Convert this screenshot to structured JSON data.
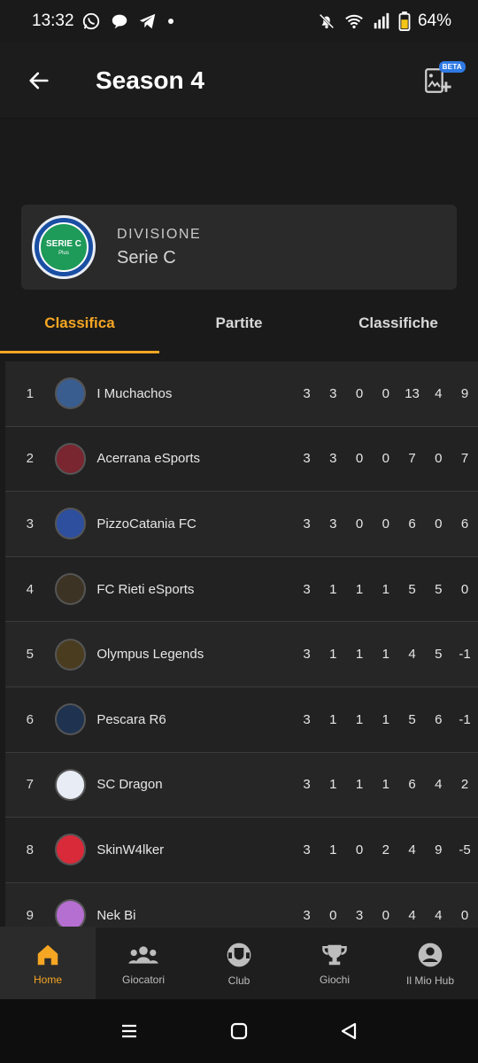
{
  "status_bar": {
    "time": "13:32",
    "battery": "64%"
  },
  "header": {
    "title": "Season 4",
    "beta_badge": "BETA"
  },
  "division": {
    "label": "DIVISIONE",
    "name": "Serie C",
    "logo_text": "SERIE C",
    "logo_sub": "Plus"
  },
  "tabs": [
    {
      "label": "Classifica",
      "active": true
    },
    {
      "label": "Partite",
      "active": false
    },
    {
      "label": "Classifiche",
      "active": false
    }
  ],
  "standings": [
    {
      "pos": "1",
      "team": "I Muchachos",
      "stats": [
        "3",
        "3",
        "0",
        "0",
        "13",
        "4",
        "9"
      ],
      "crest_color": "#3a5d8f"
    },
    {
      "pos": "2",
      "team": "Acerrana eSports",
      "stats": [
        "3",
        "3",
        "0",
        "0",
        "7",
        "0",
        "7"
      ],
      "crest_color": "#7a2630"
    },
    {
      "pos": "3",
      "team": "PizzoCatania FC",
      "stats": [
        "3",
        "3",
        "0",
        "0",
        "6",
        "0",
        "6"
      ],
      "crest_color": "#2e4f9e"
    },
    {
      "pos": "4",
      "team": "FC Rieti eSports",
      "stats": [
        "3",
        "1",
        "1",
        "1",
        "5",
        "5",
        "0"
      ],
      "crest_color": "#3d3324"
    },
    {
      "pos": "5",
      "team": "Olympus Legends",
      "stats": [
        "3",
        "1",
        "1",
        "1",
        "4",
        "5",
        "-1"
      ],
      "crest_color": "#4a3c1e"
    },
    {
      "pos": "6",
      "team": "Pescara R6",
      "stats": [
        "3",
        "1",
        "1",
        "1",
        "5",
        "6",
        "-1"
      ],
      "crest_color": "#1f3350"
    },
    {
      "pos": "7",
      "team": "SC Dragon",
      "stats": [
        "3",
        "1",
        "1",
        "1",
        "6",
        "4",
        "2"
      ],
      "crest_color": "#e8ecf4"
    },
    {
      "pos": "8",
      "team": "SkinW4lker",
      "stats": [
        "3",
        "1",
        "0",
        "2",
        "4",
        "9",
        "-5"
      ],
      "crest_color": "#d92a3a"
    },
    {
      "pos": "9",
      "team": "Nek Bi",
      "stats": [
        "3",
        "0",
        "3",
        "0",
        "4",
        "4",
        "0"
      ],
      "crest_color": "#b46fd1"
    }
  ],
  "bottom_nav": [
    {
      "label": "Home",
      "icon": "home-icon",
      "active": true
    },
    {
      "label": "Giocatori",
      "icon": "players-icon",
      "active": false
    },
    {
      "label": "Club",
      "icon": "club-icon",
      "active": false
    },
    {
      "label": "Giochi",
      "icon": "trophy-icon",
      "active": false
    },
    {
      "label": "Il Mio Hub",
      "icon": "account-icon",
      "active": false
    }
  ],
  "colors": {
    "accent": "#f5a623",
    "background": "#1a1a1a",
    "card": "#2a2a2a"
  }
}
